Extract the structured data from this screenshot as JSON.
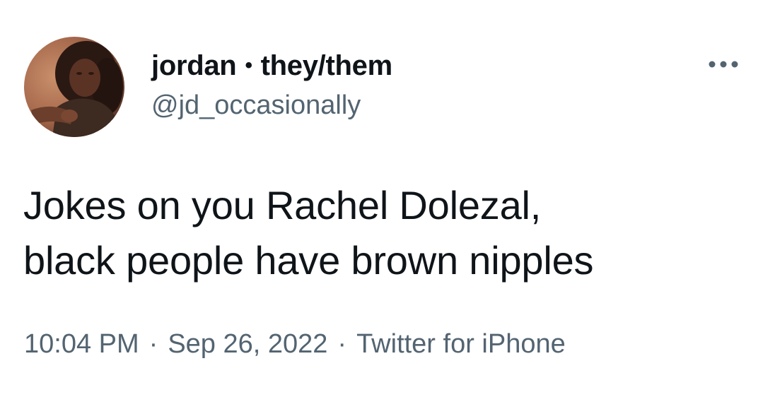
{
  "author": {
    "display_name": "jordan",
    "separator": "•",
    "pronouns": "they/them",
    "handle": "@jd_occasionally"
  },
  "icons": {
    "more": "more-horizontal-icon",
    "avatar": "profile-photo"
  },
  "tweet": {
    "lines": [
      "Jokes on you Rachel Dolezal,",
      "black people have brown nipples"
    ]
  },
  "meta": {
    "time": "10:04 PM",
    "date": "Sep 26, 2022",
    "source": "Twitter for iPhone",
    "dot": "·"
  },
  "colors": {
    "text_primary": "#0f1419",
    "text_secondary": "#536471",
    "background": "#ffffff"
  }
}
